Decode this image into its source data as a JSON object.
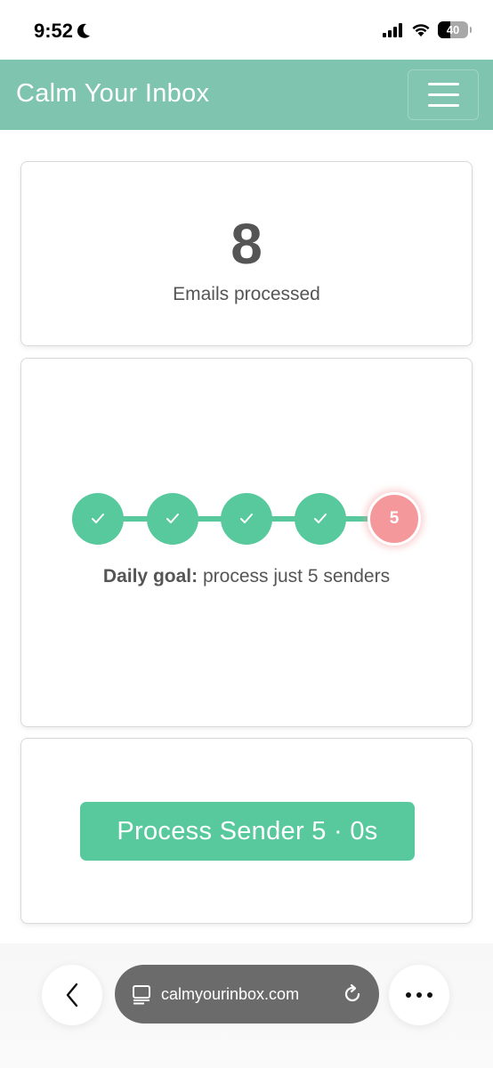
{
  "status_bar": {
    "time": "9:52",
    "battery": "40"
  },
  "header": {
    "title": "Calm Your Inbox"
  },
  "stats": {
    "count": "8",
    "label": "Emails processed"
  },
  "goal": {
    "steps": [
      {
        "state": "done",
        "label": ""
      },
      {
        "state": "done",
        "label": ""
      },
      {
        "state": "done",
        "label": ""
      },
      {
        "state": "done",
        "label": ""
      },
      {
        "state": "current",
        "label": "5"
      }
    ],
    "label_bold": "Daily goal:",
    "label_text": "process just 5 senders"
  },
  "action": {
    "button_label": "Process Sender 5 · 0s"
  },
  "browser": {
    "url": "calmyourinbox.com"
  },
  "colors": {
    "header_bg": "#7ec4ae",
    "accent_green": "#57c99d",
    "current_step": "#f4989c"
  }
}
